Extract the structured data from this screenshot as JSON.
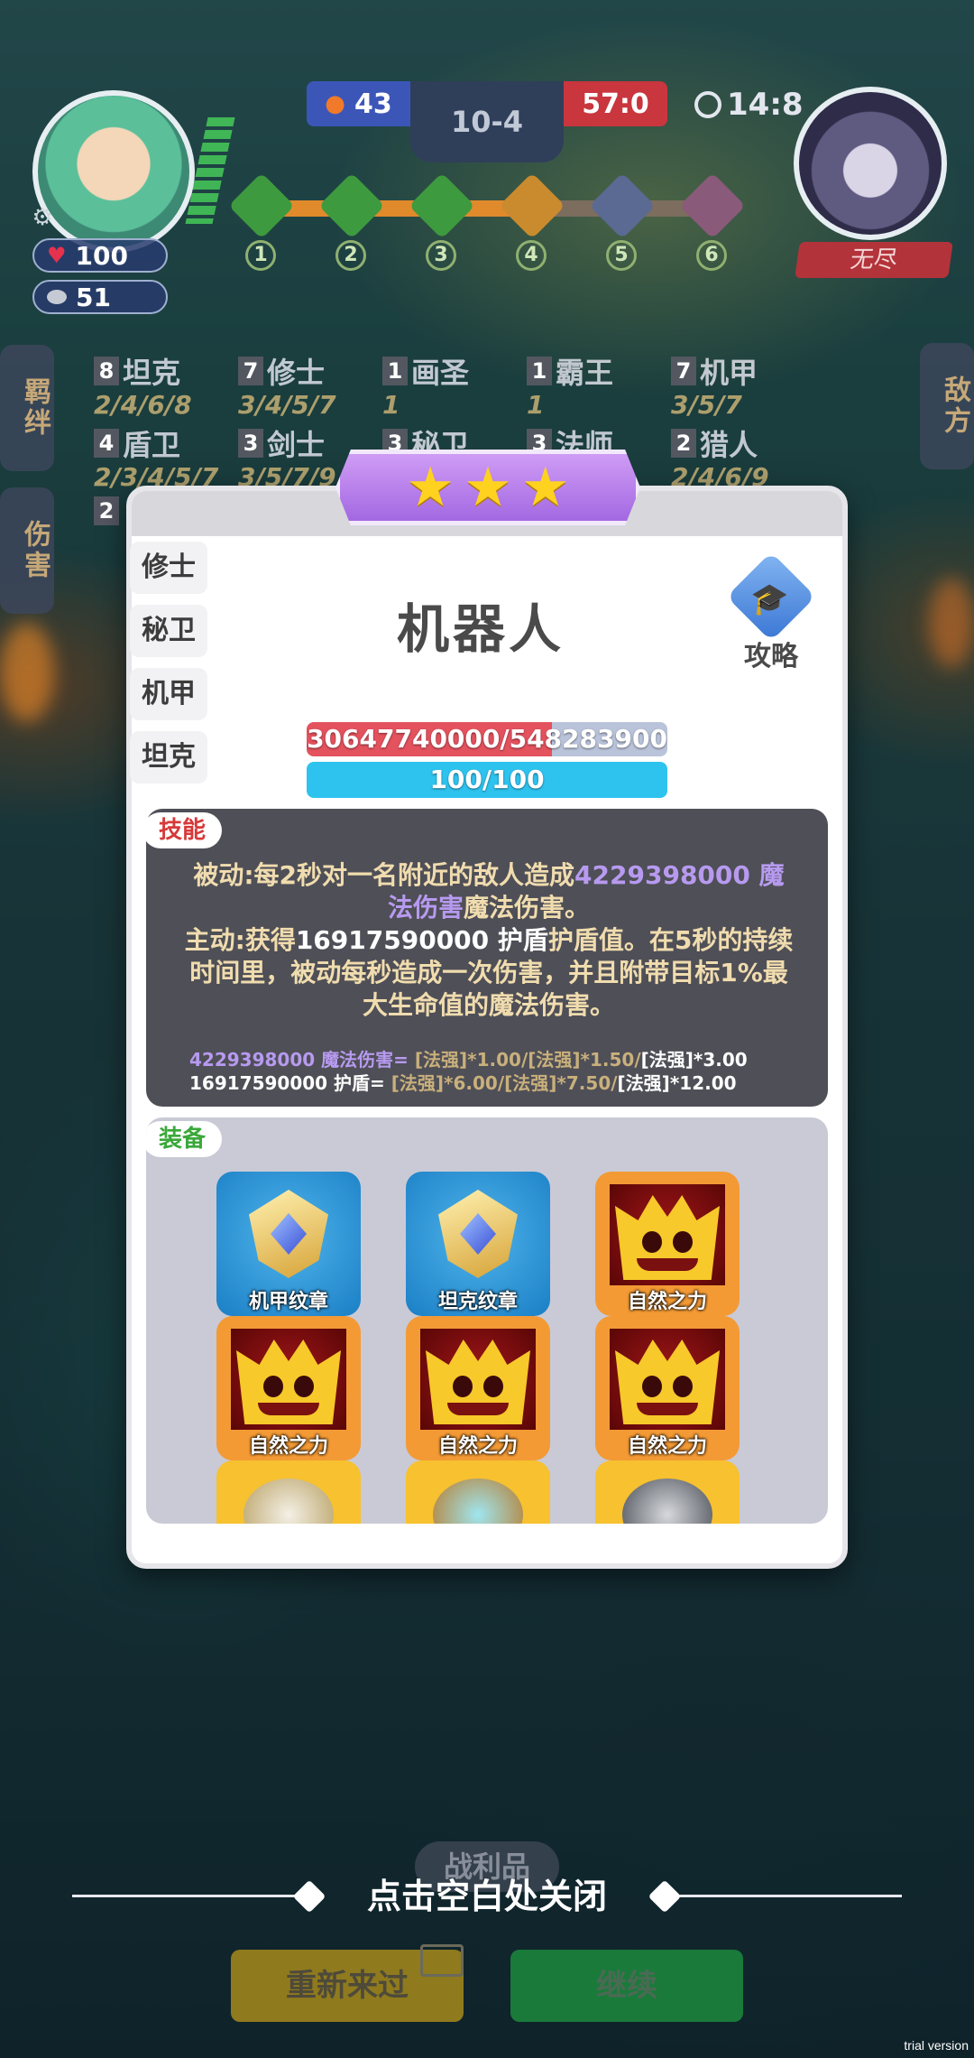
{
  "hud": {
    "player": {
      "hp": "100",
      "coins": "51"
    },
    "score": {
      "left": "43",
      "round": "10-4",
      "right": "57:0"
    },
    "timer": "14:8",
    "stages": [
      "1",
      "2",
      "3",
      "4",
      "5",
      "6"
    ],
    "boss_label": "无尽",
    "side_tabs": {
      "bonds": "羁绊",
      "damage": "伤害",
      "enemy": "敌方"
    }
  },
  "traits": [
    {
      "count": "8",
      "name": "坦克",
      "levels": "2/4/6/8"
    },
    {
      "count": "7",
      "name": "修士",
      "levels": "3/4/5/7"
    },
    {
      "count": "1",
      "name": "画圣",
      "levels": "1"
    },
    {
      "count": "1",
      "name": "霸王",
      "levels": "1"
    },
    {
      "count": "7",
      "name": "机甲",
      "levels": "3/5/7"
    },
    {
      "count": "4",
      "name": "盾卫",
      "levels": "2/3/4/5/7"
    },
    {
      "count": "3",
      "name": "剑士",
      "levels": "3/5/7/9"
    },
    {
      "count": "3",
      "name": "秘卫",
      "levels": ""
    },
    {
      "count": "3",
      "name": "法师",
      "levels": ""
    },
    {
      "count": "2",
      "name": "猎人",
      "levels": "2/4/6/9"
    },
    {
      "count": "2",
      "name": "",
      "levels": ""
    }
  ],
  "modal": {
    "star_count": 3,
    "unit_name": "机器人",
    "guide_label": "攻略",
    "trait_tabs": [
      "修士",
      "秘卫",
      "机甲",
      "坦克"
    ],
    "hp_text": "30647740000/548283900",
    "hp_fraction": 0.68,
    "mp_text": "100/100",
    "skill": {
      "tag": "技能",
      "passive_prefix": "被动:每2秒对一名附近的敌人造成",
      "passive_value": "4229398000 魔法伤害",
      "passive_suffix": "魔法伤害。",
      "active_prefix": "主动:获得",
      "active_value": "16917590000 护盾",
      "active_suffix": "护盾值。在5秒的持续时间里，被动每秒造成一次伤害，并且附带目标1%最大生命值的魔法伤害。",
      "formula1_label": "4229398000 魔法伤害=",
      "formula1_terms": "[法强]*1.00/[法强]*1.50/",
      "formula1_last": "[法强]*3.00",
      "formula2_label": "16917590000 护盾=",
      "formula2_terms": "[法强]*6.00/[法强]*7.50/",
      "formula2_last": "[法强]*12.00"
    },
    "equipment": {
      "tag": "装备",
      "items": [
        {
          "label": "机甲纹章",
          "icon": "emblem-icon",
          "color": "#1b7fc6"
        },
        {
          "label": "坦克纹章",
          "icon": "emblem-icon",
          "color": "#1b7fc6"
        },
        {
          "label": "自然之力",
          "icon": "crown-icon",
          "color": "#f39a35"
        },
        {
          "label": "自然之力",
          "icon": "crown-icon",
          "color": "#f39a35"
        },
        {
          "label": "自然之力",
          "icon": "crown-icon",
          "color": "#f39a35"
        },
        {
          "label": "自然之力",
          "icon": "crown-icon",
          "color": "#f39a35"
        }
      ]
    }
  },
  "bottom": {
    "close_hint": "点击空白处关闭",
    "ghost_label": "战利品",
    "retry_label": "重新来过",
    "continue_label": "继续",
    "watermark": "trial version"
  },
  "colors": {
    "skill_tag": "#d63a3a",
    "equip_tag": "#3aa83a",
    "hp_bar": "#e4525e",
    "mp_bar": "#2ec3ef",
    "star_banner": "#b87ae8"
  }
}
